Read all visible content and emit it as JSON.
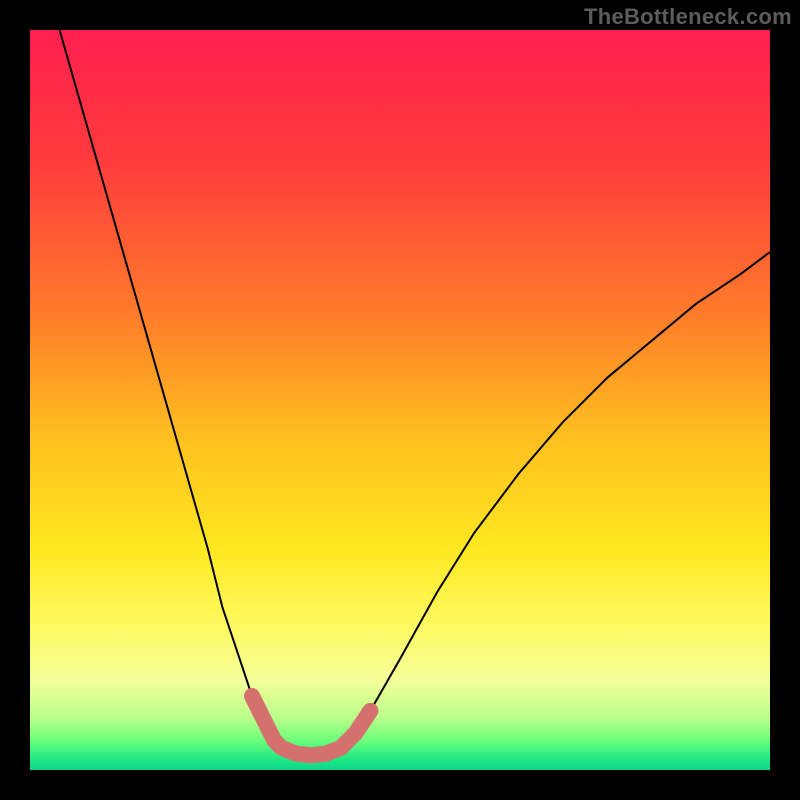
{
  "watermark": "TheBottleneck.com",
  "chart_data": {
    "type": "line",
    "title": "",
    "xlabel": "",
    "ylabel": "",
    "xlim": [
      0,
      100
    ],
    "ylim": [
      0,
      100
    ],
    "grid": false,
    "legend": false,
    "series": [
      {
        "name": "curve-left",
        "x": [
          4,
          8,
          12,
          16,
          20,
          24,
          26,
          28,
          30,
          32,
          33,
          34
        ],
        "values": [
          100,
          86,
          72,
          58,
          44,
          30,
          22,
          16,
          10,
          6,
          4,
          3
        ]
      },
      {
        "name": "curve-bottom",
        "x": [
          34,
          36,
          38,
          40,
          42
        ],
        "values": [
          3,
          2.2,
          2,
          2.2,
          3
        ]
      },
      {
        "name": "curve-right",
        "x": [
          42,
          46,
          50,
          55,
          60,
          66,
          72,
          78,
          84,
          90,
          96,
          100
        ],
        "values": [
          3,
          8,
          15,
          24,
          32,
          40,
          47,
          53,
          58,
          63,
          67,
          70
        ]
      },
      {
        "name": "thick-left-segment",
        "x": [
          30,
          32,
          33,
          34
        ],
        "values": [
          10,
          6,
          4,
          3
        ]
      },
      {
        "name": "thick-bottom-segment",
        "x": [
          34,
          36,
          38,
          40,
          42
        ],
        "values": [
          3,
          2.2,
          2,
          2.2,
          3
        ]
      },
      {
        "name": "thick-right-segment",
        "x": [
          42,
          44,
          46
        ],
        "values": [
          3,
          5,
          8
        ]
      }
    ],
    "background_gradient": {
      "stops": [
        {
          "offset": 0.0,
          "color": "#ff1f4f"
        },
        {
          "offset": 0.18,
          "color": "#ff3c3c"
        },
        {
          "offset": 0.38,
          "color": "#ff7a2a"
        },
        {
          "offset": 0.55,
          "color": "#ffbf1f"
        },
        {
          "offset": 0.7,
          "color": "#ffe81f"
        },
        {
          "offset": 0.8,
          "color": "#fff95e"
        },
        {
          "offset": 0.88,
          "color": "#f4ff9a"
        },
        {
          "offset": 0.93,
          "color": "#b8ff8a"
        },
        {
          "offset": 0.96,
          "color": "#6cff7a"
        },
        {
          "offset": 0.985,
          "color": "#20e884"
        },
        {
          "offset": 1.0,
          "color": "#0fd68c"
        }
      ]
    },
    "accent_color": "#d4716f",
    "curve_color": "#000000"
  }
}
